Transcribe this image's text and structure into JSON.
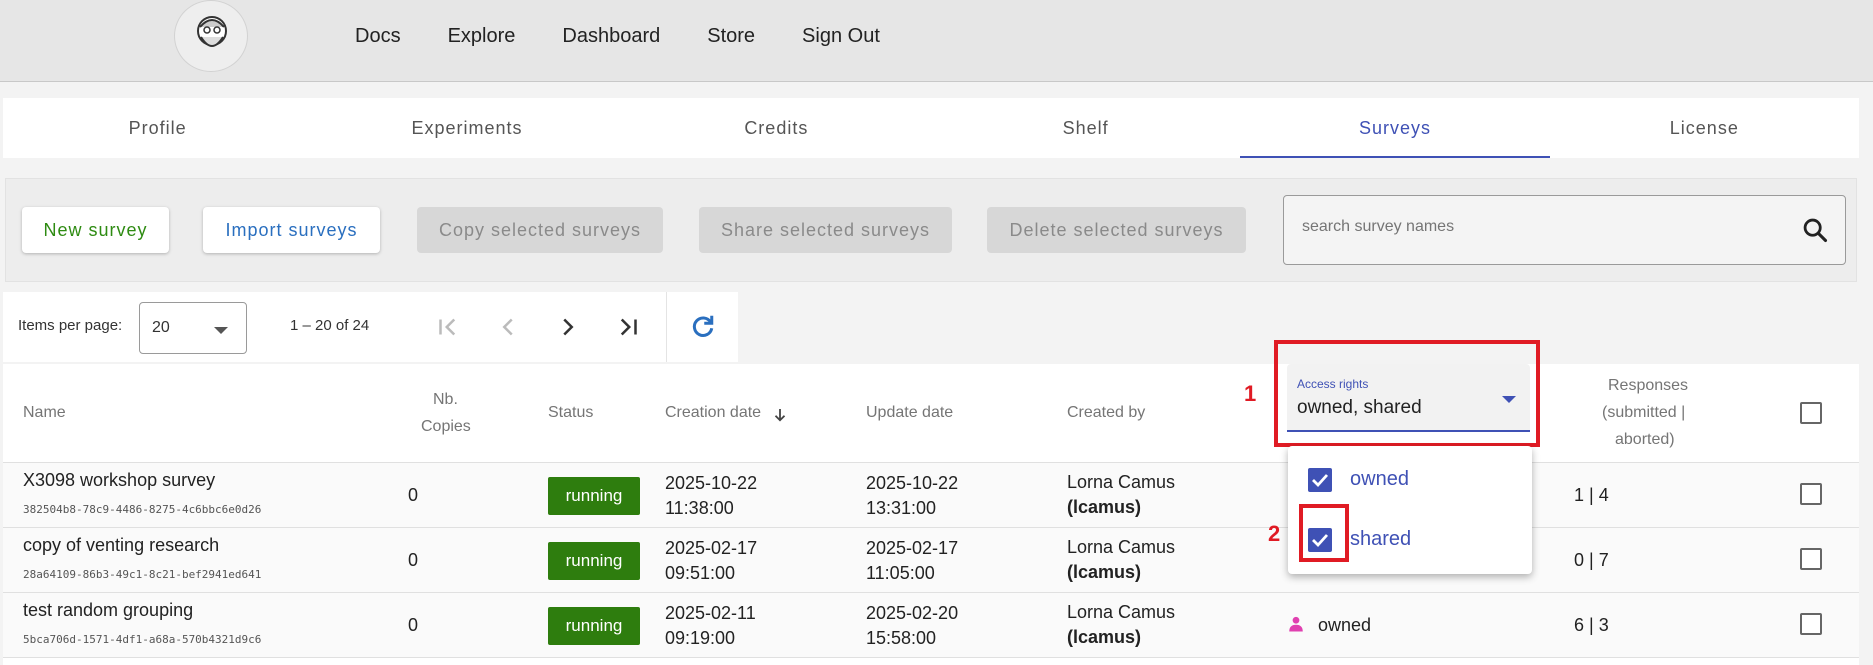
{
  "nav": {
    "items": [
      "Docs",
      "Explore",
      "Dashboard",
      "Store",
      "Sign Out"
    ]
  },
  "tabs": [
    {
      "label": "Profile"
    },
    {
      "label": "Experiments"
    },
    {
      "label": "Credits"
    },
    {
      "label": "Shelf"
    },
    {
      "label": "Surveys",
      "active": true
    },
    {
      "label": "License"
    }
  ],
  "toolbar": {
    "new_survey": "New survey",
    "import_surveys": "Import surveys",
    "copy_selected": "Copy selected surveys",
    "share_selected": "Share selected surveys",
    "delete_selected": "Delete selected surveys",
    "search_placeholder": "search survey names"
  },
  "paginator": {
    "items_per_page_label": "Items per page:",
    "items_per_page_value": "20",
    "range": "1 – 20 of 24"
  },
  "table": {
    "headers": {
      "name": "Name",
      "copies_1": "Nb.",
      "copies_2": "Copies",
      "status": "Status",
      "creation": "Creation date",
      "update": "Update date",
      "created_by": "Created by",
      "responses_1": "Responses",
      "responses_2": "(submitted |",
      "responses_3": "aborted)"
    },
    "rows": [
      {
        "name": "X3098 workshop survey",
        "uuid": "382504b8-78c9-4486-8275-4c6bbc6e0d26",
        "copies": "0",
        "status": "running",
        "created_date": "2025-10-22",
        "created_time": "11:38:00",
        "updated_date": "2025-10-22",
        "updated_time": "13:31:00",
        "creator_name": "Lorna Camus",
        "creator_login": "(lcamus)",
        "access": "",
        "responses": "1 | 4"
      },
      {
        "name": "copy of venting research",
        "uuid": "28a64109-86b3-49c1-8c21-bef2941ed641",
        "copies": "0",
        "status": "running",
        "created_date": "2025-02-17",
        "created_time": "09:51:00",
        "updated_date": "2025-02-17",
        "updated_time": "11:05:00",
        "creator_name": "Lorna Camus",
        "creator_login": "(lcamus)",
        "access": "",
        "responses": "0 | 7"
      },
      {
        "name": "test random grouping",
        "uuid": "5bca706d-1571-4df1-a68a-570b4321d9c6",
        "copies": "0",
        "status": "running",
        "created_date": "2025-02-11",
        "created_time": "09:19:00",
        "updated_date": "2025-02-20",
        "updated_time": "15:58:00",
        "creator_name": "Lorna Camus",
        "creator_login": "(lcamus)",
        "access": "owned",
        "responses": "6 | 3"
      }
    ]
  },
  "access_filter": {
    "label": "Access rights",
    "value": "owned, shared",
    "options": [
      {
        "label": "owned",
        "checked": true
      },
      {
        "label": "shared",
        "checked": true
      }
    ]
  },
  "annotations": {
    "marker_1": "1",
    "marker_2": "2"
  },
  "colors": {
    "accent": "#3f51b5",
    "running": "#2e7d0e",
    "highlight": "#e01b24",
    "new_survey": "#2e8b12",
    "import": "#2a6fbf"
  }
}
